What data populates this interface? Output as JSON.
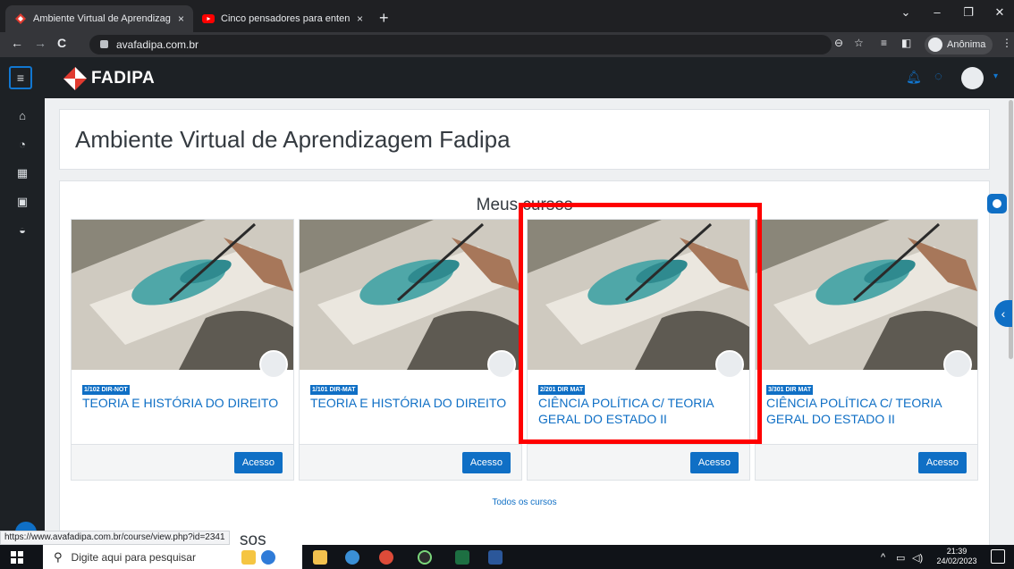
{
  "browser": {
    "tabs": [
      {
        "title": "Ambiente Virtual de Aprendizage",
        "close": "×"
      },
      {
        "title": "Cinco pensadores para entender",
        "close": "×"
      }
    ],
    "new_tab": "+",
    "url": "avafadipa.com.br",
    "profile_label": "Anônima",
    "status_url": "https://www.avafadipa.com.br/course/view.php?id=2341"
  },
  "app": {
    "logo_text": "FADIPA",
    "page_title": "Ambiente Virtual de Aprendizagem Fadipa",
    "section_title": "Meus cursos",
    "all_courses_link": "Todos os cursos",
    "peek_text": "sos",
    "courses": [
      {
        "badge": "1/102 DIR-NOT",
        "title": "TEORIA E HISTÓRIA DO DIREITO",
        "button": "Acesso"
      },
      {
        "badge": "1/101 DIR-MAT",
        "title": "TEORIA E HISTÓRIA DO DIREITO",
        "button": "Acesso"
      },
      {
        "badge": "2/201 DIR MAT",
        "title": "CIÊNCIA POLÍTICA C/ TEORIA GERAL DO ESTADO II",
        "button": "Acesso"
      },
      {
        "badge": "3/301 DIR MAT",
        "title": "CIÊNCIA POLÍTICA C/ TEORIA GERAL DO ESTADO II",
        "button": "Acesso"
      }
    ],
    "colors": {
      "brand_blue": "#0f6fc5",
      "highlight": "#ff0000",
      "nav_dark": "#1d2125"
    }
  },
  "taskbar": {
    "search_placeholder": "Digite aqui para pesquisar",
    "time": "21:39",
    "date": "24/02/2023"
  }
}
